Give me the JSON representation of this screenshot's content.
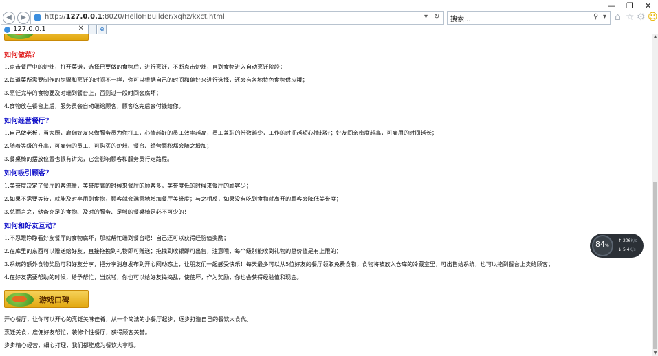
{
  "browser": {
    "address": {
      "prefix": "http://",
      "host": "127.0.0.1",
      "path": ":8020/HelloHBuilder/xqhz/kxct.html"
    },
    "search_placeholder": "搜索...",
    "tab_title": "127.0.0.1",
    "back_icon": "back-icon",
    "forward_icon": "forward-icon"
  },
  "sections": [
    {
      "heading": "如何做菜？",
      "items": [
        "1.点击餐厅中的炉灶，打开菜谱，选择已要做的食物后，进行烹饪，不断点击炉灶，直到食物进入自动烹饪阶段；",
        "2.每道菜所需要制作的步骤和烹饪的时间不一样，你可以根据自己的时间和偏好来进行选择，还会有各地特色食物供应哦；",
        "3.烹饪完毕的食物要及时端到餐台上，否则过一段时间会腐坏；",
        "4.食物放在餐台上后，服务员会自动端给顾客，顾客吃完后会付钱给你。"
      ]
    },
    {
      "heading": "如何经营餐厅？",
      "items": [
        "1.自己做老板，当大厨，雇佣好友来做服务员为你打工，心情越好的员工效率越高，员工兼职的份数越少，工作的时间越短心情越好；好友间亲密度越高，可雇用的时间越长；",
        "2.随着等级的升高，可雇佣的员工、可购买的炉灶、餐台、经营面积都会随之增加；",
        "3.餐桌椅的摆放位置也很有讲究，它会影响顾客和服务员行走路程。"
      ]
    },
    {
      "heading": "如何吸引顾客？",
      "items": [
        "1.美誉度决定了餐厅的客流量，美誉度高的时候来餐厅的顾客多，美誉度低的时候来餐厅的顾客少；",
        "2.如果不需要等待，就能及时享用到食物，顾客就会满意地增加餐厅美誉度；与之相反，如果没有吃到食物就离开的顾客会降低美誉度；",
        "3.总而言之，储备充足的食物、及时的服务、足够的餐桌椅是必不可少的！"
      ]
    },
    {
      "heading": "如何和好友互动？",
      "items": [
        "1.不忍眼睁睁看好友餐厅的食物腐坏，那就帮忙端到餐台吧！自己还可以获得经验值奖励；",
        "2.在库里的东西可以赠送给好友，直接拖拽到礼物即可赠送；拖拽到收银即可出售，注意哦，每个级别能收到礼物的总价值是有上限的；",
        "3.系统的额外食物奖励可和好友分享，把分享消息发布到开心网动态上，让朋友们一起感受快乐！每天最多可以从5位好友的餐厅领取免费食物，食物将被放入仓库的冷藏室里，可出售给系统，也可以拖到餐台上卖给顾客；",
        "4.在好友需要帮助的时候，给予帮忙，当然啦，你也可以给好友捣捣乱，使使坏，作为奖励，你也会获得经验值和现金。"
      ]
    }
  ],
  "reviews": {
    "banner_label": "游戏口碑",
    "lines": [
      "开心餐厅，让你可以开心的烹饪美味佳肴，从一个简法的小餐厅起步，逐步打造自己的餐饮大食代。",
      "烹饪美食，雇佣好友帮忙，装修个性餐厅，获得顾客美誉。",
      "步步精心经营，细心打理，我们都能成为餐饮大亨哦。"
    ]
  },
  "widget": {
    "percent": "84",
    "unit": "%",
    "line1": "206",
    "line1_unit": "K/s",
    "line2": "5.4",
    "line2_unit": "K/s"
  },
  "colors": {
    "heading_red": "#e01f1f",
    "heading_blue": "#0b0bc8",
    "banner_gold": "#e9b024"
  }
}
